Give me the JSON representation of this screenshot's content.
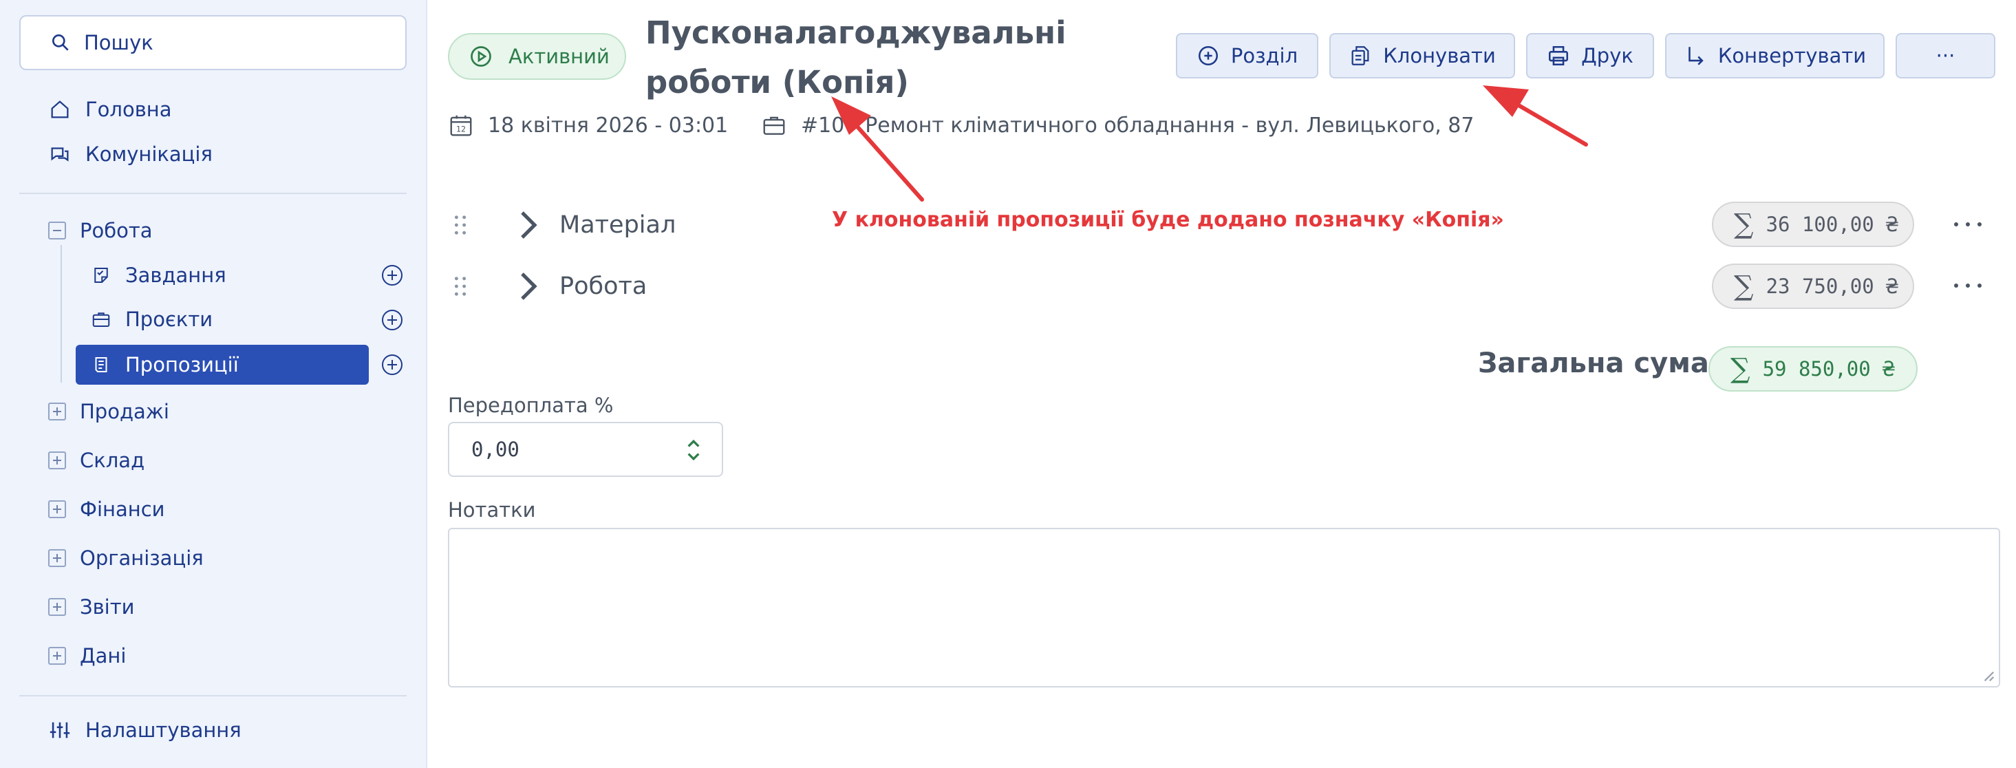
{
  "sidebar": {
    "search_placeholder": "Пошук",
    "top_items": [
      {
        "label": "Головна",
        "icon": "home-icon"
      },
      {
        "label": "Комунікація",
        "icon": "chat-icon"
      }
    ],
    "work_group": {
      "label": "Робота",
      "expanded": true,
      "children": [
        {
          "label": "Завдання",
          "icon": "task-icon"
        },
        {
          "label": "Проєкти",
          "icon": "briefcase-icon"
        },
        {
          "label": "Пропозиції",
          "icon": "offer-icon",
          "active": true
        }
      ]
    },
    "groups": [
      "Продажі",
      "Склад",
      "Фінанси",
      "Організація",
      "Звіти",
      "Дані"
    ],
    "settings_label": "Налаштування"
  },
  "header": {
    "status": "Активний",
    "title_line1": "Пусконалагоджувальні",
    "title_line2": "роботи (Копія)",
    "date": "18 квітня 2026 - 03:01",
    "project": "#10  - Ремонт кліматичного обладнання - вул. Левицького, 87"
  },
  "toolbar": {
    "section_label": "Розділ",
    "clone_label": "Клонувати",
    "print_label": "Друк",
    "convert_label": "Конвертувати",
    "more_label": "···"
  },
  "sections": [
    {
      "label": "Матеріал",
      "sum": "36 100,00 ₴"
    },
    {
      "label": "Робота",
      "sum": "23 750,00 ₴"
    }
  ],
  "total": {
    "label": "Загальна сума",
    "sum": "59 850,00 ₴"
  },
  "sigma": "∑",
  "prepayment": {
    "label": "Передоплата %",
    "value": "0,00"
  },
  "notes": {
    "label": "Нотатки",
    "value": ""
  },
  "annotation": {
    "text": "У клонованій пропозиції буде додано позначку «Копія»",
    "color": "#e5383b"
  },
  "colors": {
    "accent": "#2a4fb5",
    "success": "#2e7d4a",
    "annotation": "#e5383b"
  }
}
